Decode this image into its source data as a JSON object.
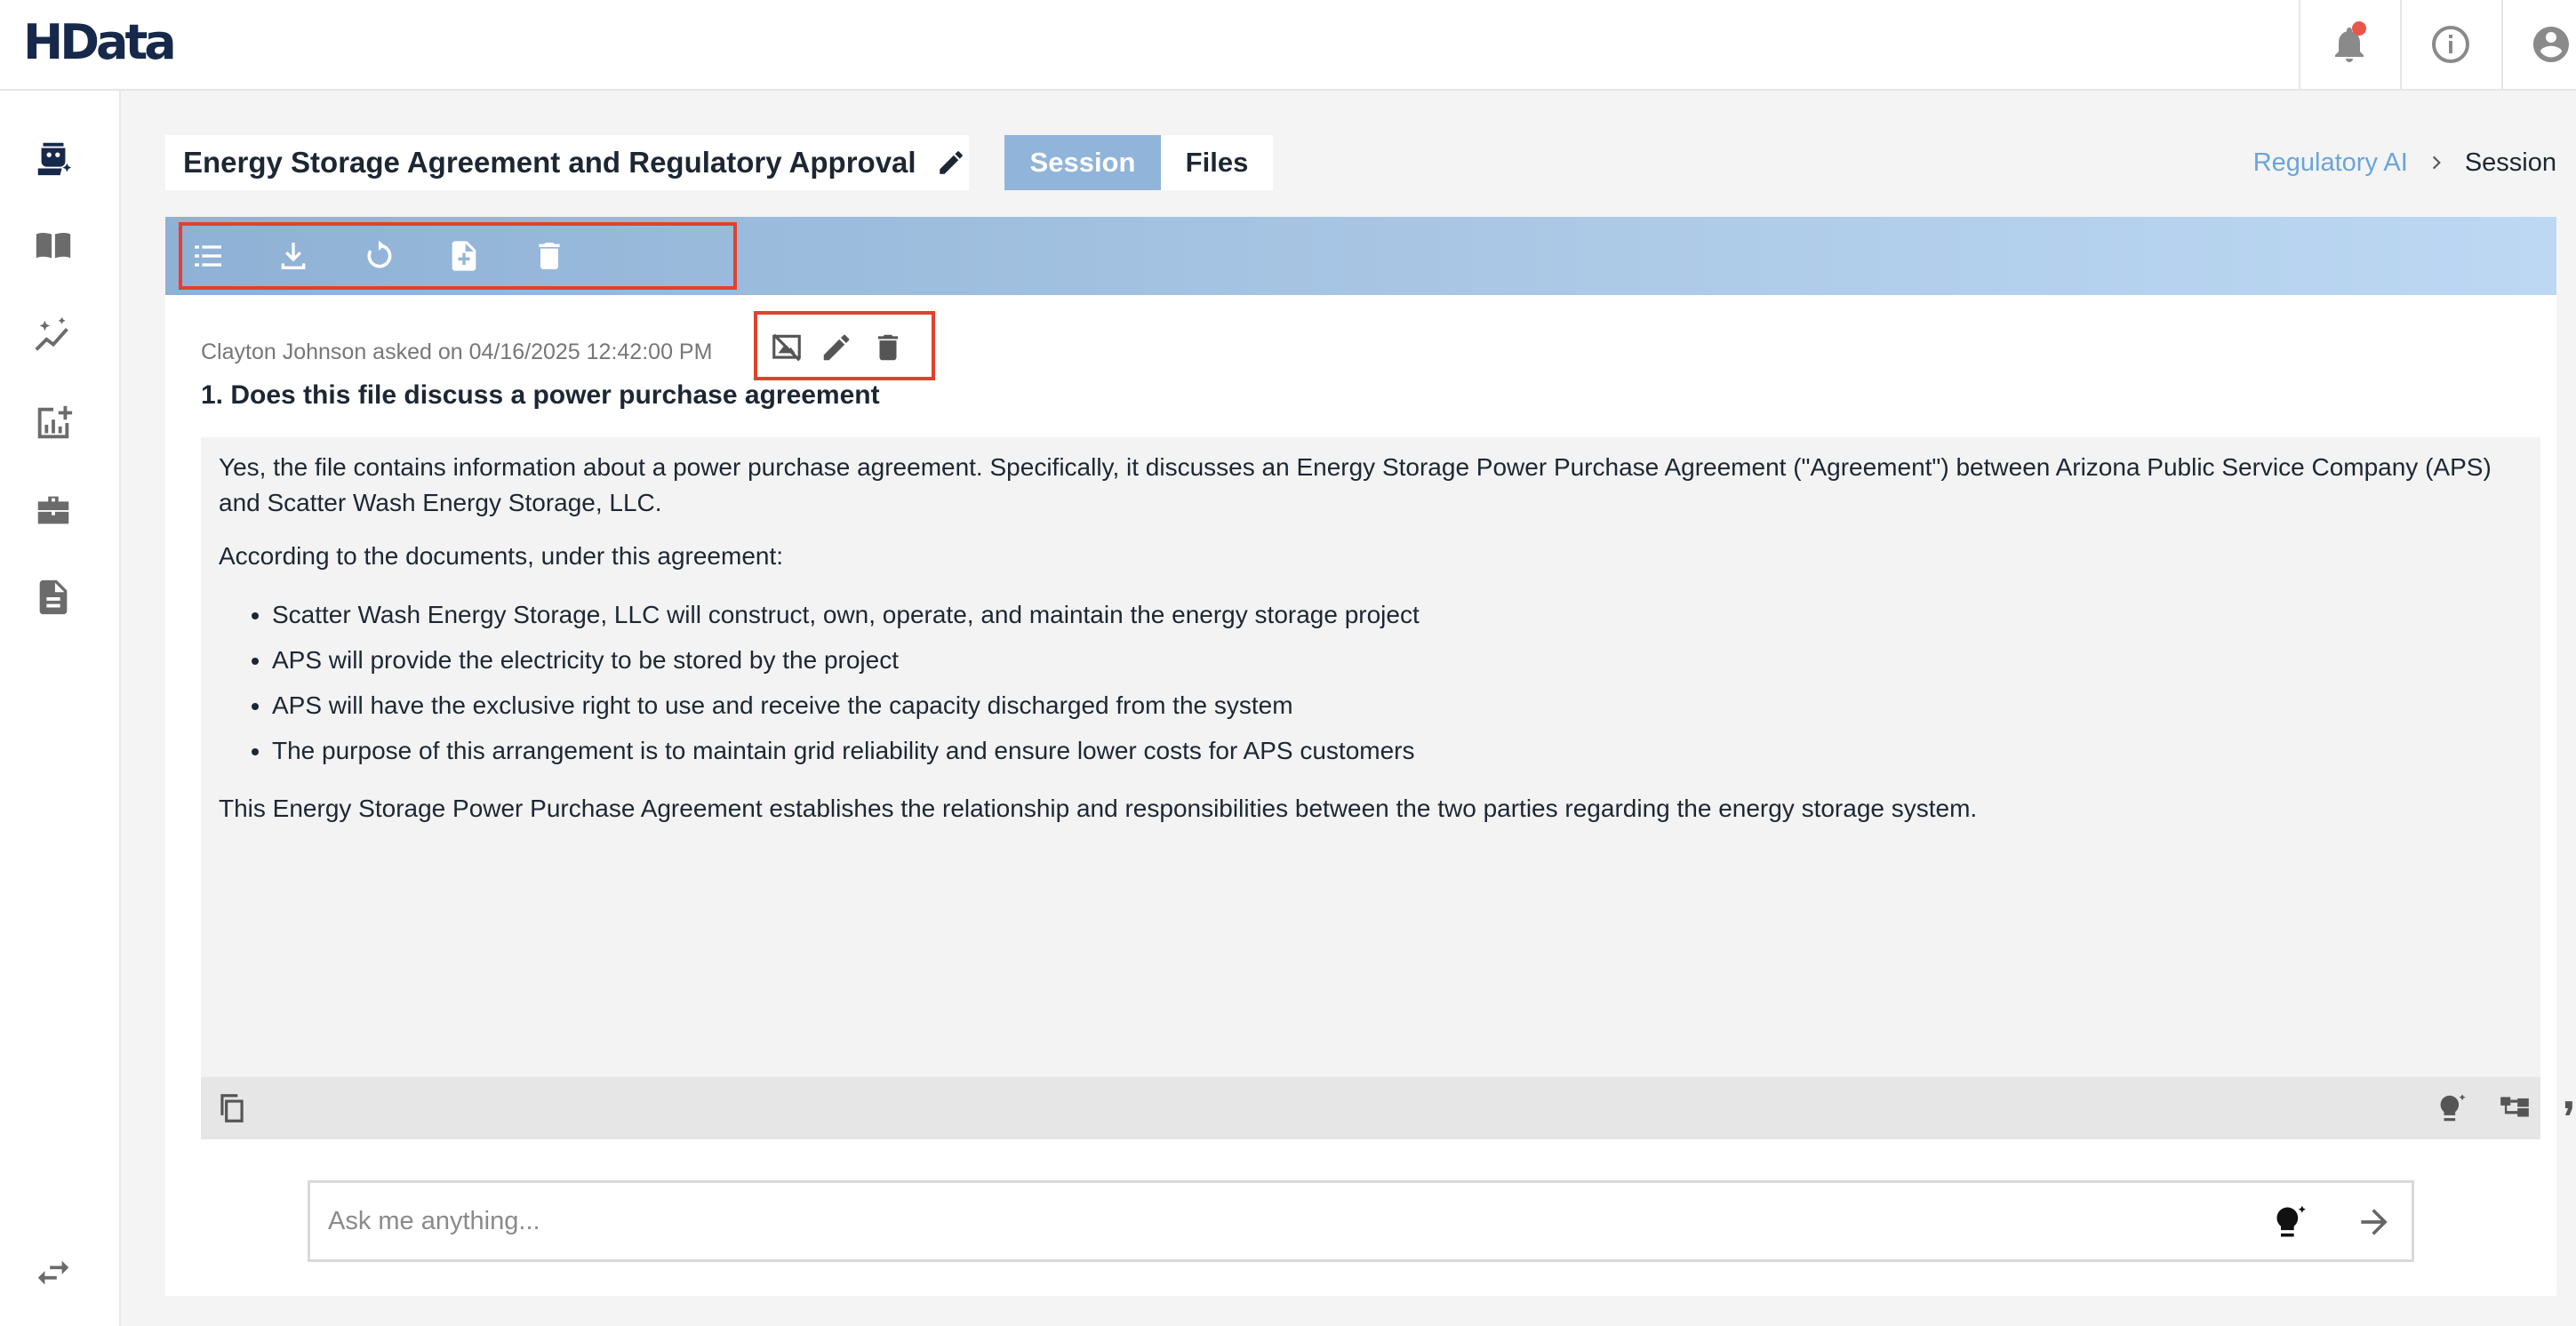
{
  "app": {
    "logo": "HData"
  },
  "header": {
    "title": "Energy Storage Agreement and Regulatory Approval",
    "tabs": [
      {
        "label": "Session",
        "active": true
      },
      {
        "label": "Files",
        "active": false
      }
    ],
    "breadcrumb": {
      "parent": "Regulatory AI",
      "current": "Session"
    }
  },
  "topbar": {
    "icons": [
      "bell-icon",
      "info-icon",
      "account-icon"
    ],
    "notification_dot": true
  },
  "sidebar": {
    "icons": [
      "regulatory-ai-bot-icon",
      "book-icon",
      "sparkle-chart-icon",
      "analytics-icon",
      "toolbox-icon",
      "document-icon",
      "swap-icon"
    ]
  },
  "toolbar": {
    "icons": [
      "list-icon",
      "download-icon",
      "refresh-icon",
      "new-file-icon",
      "trash-icon"
    ]
  },
  "conversation": {
    "meta": "Clayton Johnson asked on 04/16/2025 12:42:00 PM",
    "question": "1. Does this file discuss a power purchase agreement",
    "answer": {
      "paragraph_1": "Yes, the file contains information about a power purchase agreement. Specifically, it discusses an Energy Storage Power Purchase Agreement (\"Agreement\") between Arizona Public Service Company (APS) and Scatter Wash Energy Storage, LLC.",
      "paragraph_2": "According to the documents, under this agreement:",
      "bullets": [
        "Scatter Wash Energy Storage, LLC will construct, own, operate, and maintain the energy storage project",
        "APS will provide the electricity to be stored by the project",
        "APS will have the exclusive right to use and receive the capacity discharged from the system",
        "The purpose of this arrangement is to maintain grid reliability and ensure lower costs for APS customers"
      ],
      "paragraph_3": "This Energy Storage Power Purchase Agreement establishes the relationship and responsibilities between the two parties regarding the energy storage system."
    }
  },
  "ask": {
    "placeholder": "Ask me anything..."
  },
  "colors": {
    "accent": "#90b4da",
    "link": "#6aa4dc",
    "highlight": "#e0412f",
    "notification": "#e8574a"
  }
}
